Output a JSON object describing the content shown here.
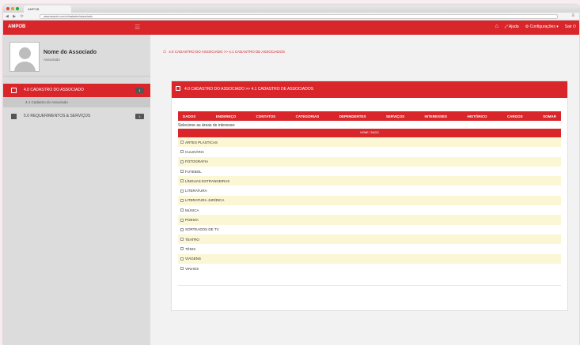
{
  "browser": {
    "tab_title": "AMPOB",
    "url": "www.ampob.com.br/cadastro/associado",
    "nav": "◀ ▶ ⟳"
  },
  "topbar": {
    "brand": "AMPOB",
    "links": [
      "Ajuda",
      "Configurações ▾",
      "Sair"
    ]
  },
  "sidebar": {
    "user_name": "Nome do Associado",
    "user_role": "Associado",
    "items": [
      {
        "label": "4.0 CADASTRO DO ASSOCIADO",
        "badge": "1",
        "active": true
      },
      {
        "label": "5.0 REQUERIMENTOS & SERVIÇOS",
        "badge": "1",
        "active": false
      }
    ],
    "sub_items": [
      "4.1 Cadastro do Associado"
    ]
  },
  "breadcrumb": "4.0 CADASTRO DO ASSOCIADO >> 4.1 CADASTRO DE ASSOCIADOS",
  "panel": {
    "title": "4.0 CADASTRO DO ASSOCIADO >> 4.1 CADASTRO DE ASSOCIADOS",
    "tabs": [
      "DADOS",
      "ENDEREÇO",
      "CONTATOS",
      "CATEGORIAS",
      "DEPENDENTES",
      "SERVIÇOS",
      "INTERESSES",
      "HISTÓRICO",
      "CARGOS",
      "SOMAR"
    ],
    "instruction": "Selecione as áreas de interesse:",
    "table_header": "NOME / DADO",
    "interests": [
      "ARTES PLÁSTICAS",
      "CULINÁRIA",
      "FOTOGRAFIA",
      "FUTEBOL",
      "LÍNGUAS ESTRANGEIRAS",
      "LITERATURA",
      "LITERATURA JURÍDICA",
      "MÚSICA",
      "POESIA",
      "SORTEADOS DE TV",
      "TEATRO",
      "TÊNIS",
      "VIAGENS",
      "VINHOS"
    ]
  },
  "colors": {
    "brand": "#d8262b",
    "row_alt": "#fbf6d3",
    "sidebar": "#dcdcdc"
  }
}
